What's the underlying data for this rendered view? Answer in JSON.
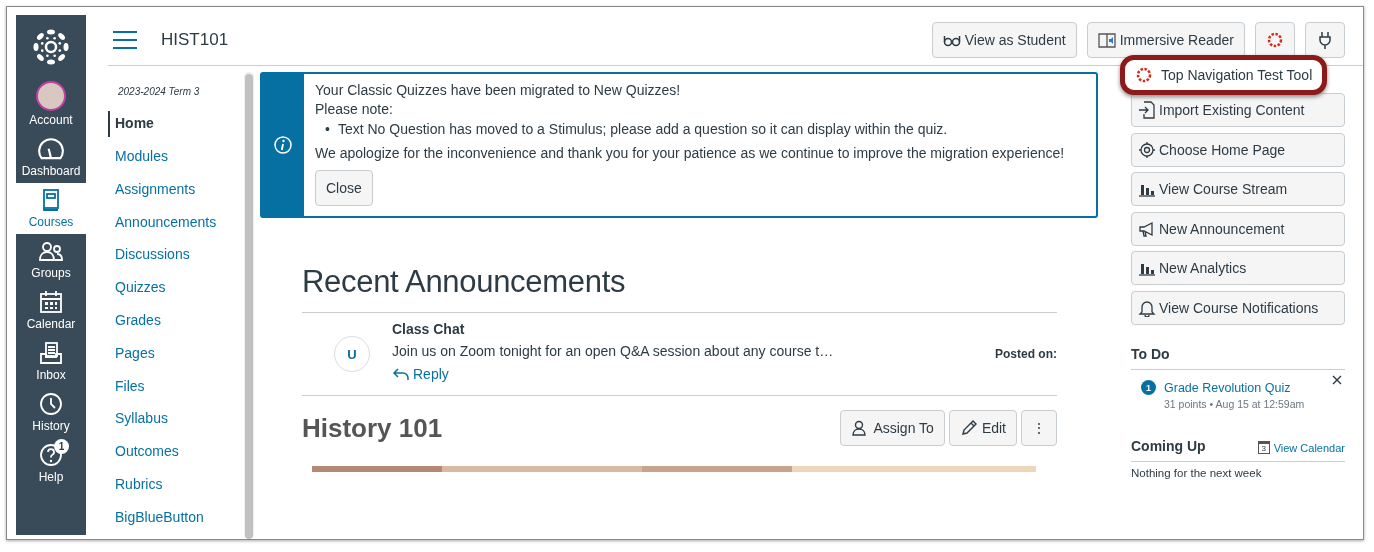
{
  "global_nav": {
    "items": [
      {
        "label": "Account",
        "kind": "avatar",
        "selected": false
      },
      {
        "label": "Dashboard",
        "kind": "dashboard",
        "selected": false
      },
      {
        "label": "Courses",
        "kind": "courses",
        "selected": true
      },
      {
        "label": "Groups",
        "kind": "groups",
        "selected": false
      },
      {
        "label": "Calendar",
        "kind": "calendar",
        "selected": false
      },
      {
        "label": "Inbox",
        "kind": "inbox",
        "selected": false
      },
      {
        "label": "History",
        "kind": "history",
        "selected": false
      },
      {
        "label": "Help",
        "kind": "help",
        "selected": false,
        "badge": "1"
      }
    ]
  },
  "header": {
    "course_code": "HIST101",
    "buttons": [
      {
        "kind": "glasses",
        "label": "View as Student"
      },
      {
        "kind": "reader",
        "label": "Immersive Reader"
      },
      {
        "kind": "tool"
      },
      {
        "kind": "plug"
      }
    ]
  },
  "tool_menu": {
    "items": [
      {
        "label": "Top Navigation Test Tool",
        "highlighted": true
      }
    ]
  },
  "course_nav": {
    "term": "2023-2024 Term 3",
    "items": [
      {
        "label": "Home",
        "selected": true
      },
      {
        "label": "Modules",
        "selected": false
      },
      {
        "label": "Assignments",
        "selected": false
      },
      {
        "label": "Announcements",
        "selected": false
      },
      {
        "label": "Discussions",
        "selected": false
      },
      {
        "label": "Quizzes",
        "selected": false
      },
      {
        "label": "Grades",
        "selected": false
      },
      {
        "label": "Pages",
        "selected": false
      },
      {
        "label": "Files",
        "selected": false
      },
      {
        "label": "Syllabus",
        "selected": false
      },
      {
        "label": "Outcomes",
        "selected": false
      },
      {
        "label": "Rubrics",
        "selected": false
      },
      {
        "label": "BigBlueButton",
        "selected": false
      }
    ]
  },
  "alert": {
    "lines": [
      "Your Classic Quizzes have been migrated to New Quizzes!",
      "Please note:"
    ],
    "bullets": [
      {
        "marker": "•",
        "text": "Text No Question has moved to a Stimulus; please add a question so it can display within the quiz."
      }
    ],
    "closing": "We apologize for the inconvenience and thank you for your patience as we continue to improve the migration experience!",
    "button": "Close"
  },
  "announcements": {
    "heading": "Recent Announcements",
    "items": [
      {
        "avatar": "U",
        "title": "Class Chat",
        "body": "Join us on Zoom tonight for an open Q&A session about any course t…",
        "reply": "Reply",
        "posted": "Posted on:"
      }
    ]
  },
  "course_home": {
    "title": "History 101",
    "buttons": [
      {
        "kind": "assign",
        "label": "Assign To"
      },
      {
        "kind": "edit",
        "label": "Edit"
      },
      {
        "kind": "more",
        "label": "⋮"
      }
    ]
  },
  "sidebar": {
    "buttons": [
      {
        "kind": "import",
        "label": "Import Existing Content"
      },
      {
        "kind": "home",
        "label": "Choose Home Page"
      },
      {
        "kind": "stream",
        "label": "View Course Stream"
      },
      {
        "kind": "announce",
        "label": "New Announcement"
      },
      {
        "kind": "stream",
        "label": "New Analytics"
      },
      {
        "kind": "bell",
        "label": "View Course Notifications"
      }
    ],
    "todo": {
      "heading": "To Do",
      "items": [
        {
          "count": "1",
          "title": "Grade Revolution Quiz",
          "meta": "31 points • Aug 15 at 12:59am"
        }
      ]
    },
    "coming_up": {
      "heading": "Coming Up",
      "calendar_day": "3",
      "link": "View Calendar",
      "empty": "Nothing for the next week"
    }
  }
}
